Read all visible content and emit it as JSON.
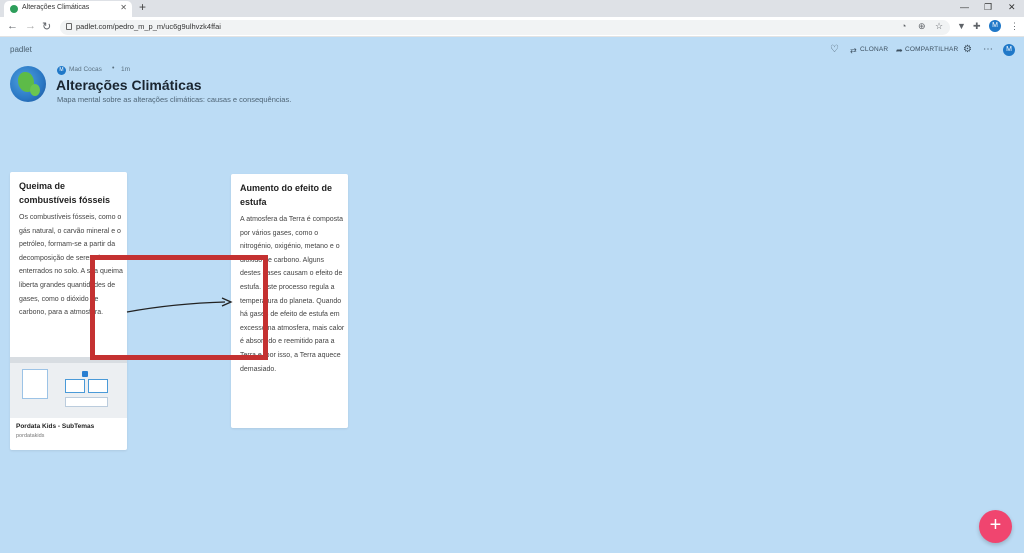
{
  "browser": {
    "tab_title": "Alterações Climáticas",
    "url": "padlet.com/pedro_m_p_m/uc6g9ulhvzk4ffai",
    "profile_initial": "M"
  },
  "padlet": {
    "logo": "padlet",
    "actions": {
      "clone": "CLONAR",
      "share": "COMPARTILHAR"
    },
    "user_initial": "M",
    "author": "Mad Cocas",
    "author_initial": "M",
    "time": "1m",
    "title": "Alterações Climáticas",
    "subtitle": "Mapa mental sobre as alterações climáticas: causas e consequências."
  },
  "cards": [
    {
      "title": "Queima de combustíveis fósseis",
      "body": "Os combustíveis fósseis, como o gás natural, o carvão mineral e o petróleo, formam-se a partir da decomposição de seres vivos enterrados no solo. A sua queima liberta grandes quantidades de gases, como o dióxido de carbono, para a atmosfera.",
      "attachment": {
        "title": "Pordata Kids - SubTemas",
        "source": "pordatakids"
      }
    },
    {
      "title": "Aumento do efeito de estufa",
      "body": "A atmosfera da Terra é composta por vários gases, como o nitrogénio, oxigénio, metano e o dióxido de carbono. Alguns destes gases causam o efeito de estufa. Este processo regula a temperatura do planeta. Quando há gases de efeito de estufa em excesso na atmosfera, mais calor é absorvido e reemitido para a Terra e, por isso, a Terra aquece demasiado."
    }
  ],
  "colors": {
    "background": "#bcdcf5",
    "highlight": "#c43131",
    "fab": "#f0456f"
  }
}
